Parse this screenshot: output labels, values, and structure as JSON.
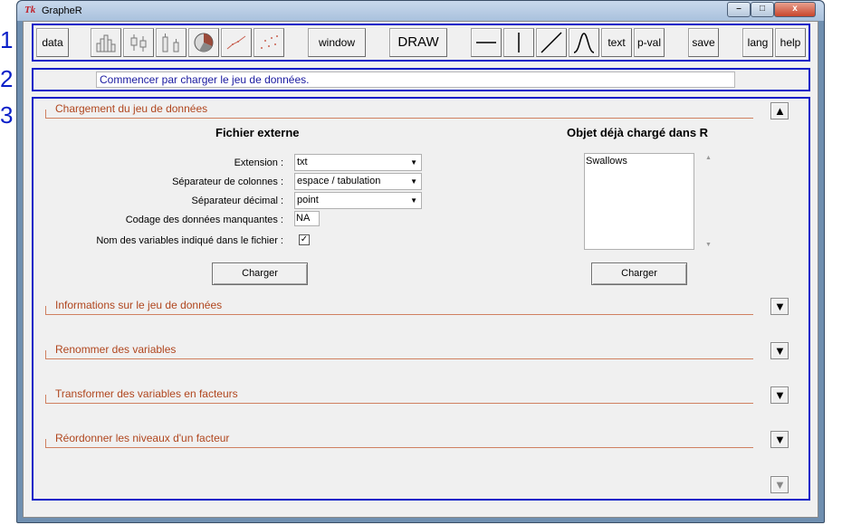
{
  "window": {
    "title": "GrapheR",
    "logo": "Tk",
    "min_label": "–",
    "max_label": "□",
    "close_label": "x"
  },
  "markers": [
    "1",
    "2",
    "3"
  ],
  "toolbar": {
    "data": "data",
    "window": "window",
    "draw": "DRAW",
    "text": "text",
    "pval": "p-val",
    "save": "save",
    "lang": "lang",
    "help": "help"
  },
  "status": {
    "message": "Commencer par charger le jeu de données."
  },
  "sections": {
    "load": "Chargement du jeu de données",
    "info": "Informations sur le jeu de données",
    "rename": "Renommer des variables",
    "transform": "Transformer des variables en facteurs",
    "reorder": "Réordonner les niveaux d'un facteur"
  },
  "load_panel": {
    "external_title": "Fichier externe",
    "loaded_title": "Objet déjà chargé dans R",
    "extension_label": "Extension :",
    "extension_value": "txt",
    "col_sep_label": "Séparateur de colonnes :",
    "col_sep_value": "espace / tabulation",
    "dec_sep_label": "Séparateur décimal :",
    "dec_sep_value": "point",
    "missing_label": "Codage des données manquantes :",
    "missing_value": "NA",
    "header_label": "Nom des variables indiqué dans le fichier :",
    "header_checked": true,
    "load_button": "Charger",
    "objects": [
      "Swallows"
    ],
    "load_button_2": "Charger"
  },
  "colors": {
    "frame_blue": "#0a1fc8",
    "section_text": "#b0461e",
    "status_text": "#1a1aa0"
  },
  "icons": [
    "histogram-icon",
    "boxplot-icon",
    "barplot-icon",
    "pie-chart-icon",
    "line-chart-icon",
    "scatter-plot-icon",
    "horizontal-line-icon",
    "vertical-line-icon",
    "diagonal-line-icon",
    "curve-icon",
    "collapse-arrow-icon",
    "expand-arrow-icon",
    "scroll-down-icon"
  ]
}
